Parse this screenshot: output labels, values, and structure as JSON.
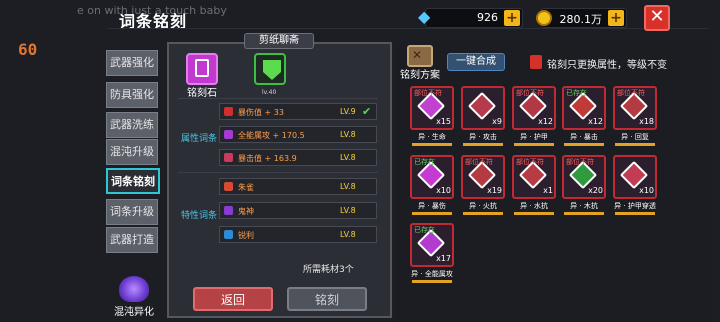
{
  "overlay_text": "e on with just a touch baby",
  "fps": "60",
  "title": "词条铭刻",
  "resources": {
    "diamonds": "926",
    "gold": "280.1万"
  },
  "close_label": "✕",
  "nav": [
    "武器强化",
    "防具强化",
    "武器洗练",
    "混沌升级",
    "词条铭刻",
    "词条升级",
    "武器打造"
  ],
  "nav_active_index": 4,
  "bottom_nav_label": "混沌异化",
  "panel": {
    "tab": "剪纸聊斋",
    "slot1_label": "铭刻石",
    "slot2_level": "lv.40",
    "attr_title": "属性词条",
    "trait_title": "特性词条",
    "attr_rows": [
      {
        "text": "暴伤值 + 33",
        "lv": "LV.9",
        "check": "✔"
      },
      {
        "text": "全能属攻 + 170.5",
        "lv": "LV.8",
        "check": ""
      },
      {
        "text": "暴击值 + 163.9",
        "lv": "LV.8",
        "check": ""
      }
    ],
    "trait_rows": [
      {
        "text": "朱雀",
        "lv": "LV.8"
      },
      {
        "text": "鬼神",
        "lv": "LV.8"
      },
      {
        "text": "锐利",
        "lv": "LV.8"
      }
    ],
    "requirement": "所需耗材3个",
    "back_label": "返回",
    "engrave_label": "铭刻"
  },
  "right": {
    "scheme_label": "铭刻方案",
    "oneclick_label": "一键合成",
    "warning": "铭刻只更换属性，等级不变",
    "cards": [
      {
        "flag": "部位不符",
        "count": "x15",
        "label": "异 · 生命",
        "color": "#c042cf"
      },
      {
        "flag": "",
        "count": "x9",
        "label": "异 · 攻击",
        "color": "#b53a4c"
      },
      {
        "flag": "部位不符",
        "count": "x12",
        "label": "异 · 护甲",
        "color": "#b23845"
      },
      {
        "flag": "已存在",
        "count": "x12",
        "label": "异 · 暴击",
        "color": "#c13a3a"
      },
      {
        "flag": "部位不符",
        "count": "x18",
        "label": "异 · 回复",
        "color": "#b23a40"
      },
      {
        "flag": "已存在",
        "count": "x10",
        "label": "异 · 暴伤",
        "color": "#c53ad1"
      },
      {
        "flag": "部位不符",
        "count": "x19",
        "label": "异 · 火抗",
        "color": "#b53b43"
      },
      {
        "flag": "部位不符",
        "count": "x1",
        "label": "异 · 水抗",
        "color": "#b73a45"
      },
      {
        "flag": "部位不符",
        "count": "x20",
        "label": "异 · 木抗",
        "color": "#2f9a3e"
      },
      {
        "flag": "",
        "count": "x10",
        "label": "异 · 护甲穿透",
        "color": "#c23d54"
      },
      {
        "flag": "已存在",
        "count": "x17",
        "label": "异 · 全能属攻",
        "color": "#b23bd0"
      }
    ]
  }
}
